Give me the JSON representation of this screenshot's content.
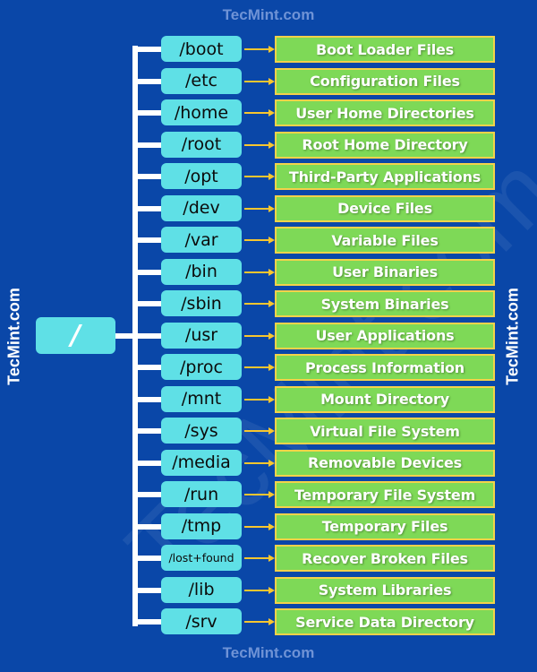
{
  "site": {
    "top_label": "TecMint.com",
    "bottom_label": "TecMint.com",
    "left_label": "TecMint.com",
    "right_label": "TecMint.com",
    "watermark": "TecMint.com"
  },
  "colors": {
    "background": "#0a47a8",
    "dir_box": "#5fe0e6",
    "desc_box": "#7ed957",
    "desc_border": "#f4d24a",
    "arrow": "#f7c62f",
    "connector": "#ffffff"
  },
  "root": {
    "label": "/"
  },
  "directories": [
    {
      "path": "/boot",
      "description": "Boot Loader Files"
    },
    {
      "path": "/etc",
      "description": "Configuration Files"
    },
    {
      "path": "/home",
      "description": "User Home Directories"
    },
    {
      "path": "/root",
      "description": "Root Home Directory"
    },
    {
      "path": "/opt",
      "description": "Third-Party Applications"
    },
    {
      "path": "/dev",
      "description": "Device Files"
    },
    {
      "path": "/var",
      "description": "Variable Files"
    },
    {
      "path": "/bin",
      "description": "User Binaries"
    },
    {
      "path": "/sbin",
      "description": "System Binaries"
    },
    {
      "path": "/usr",
      "description": "User Applications"
    },
    {
      "path": "/proc",
      "description": "Process Information"
    },
    {
      "path": "/mnt",
      "description": "Mount Directory"
    },
    {
      "path": "/sys",
      "description": "Virtual File System"
    },
    {
      "path": "/media",
      "description": "Removable Devices"
    },
    {
      "path": "/run",
      "description": "Temporary File System"
    },
    {
      "path": "/tmp",
      "description": "Temporary Files"
    },
    {
      "path": "/lost+found",
      "description": "Recover Broken Files"
    },
    {
      "path": "/lib",
      "description": "System Libraries"
    },
    {
      "path": "/srv",
      "description": "Service Data Directory"
    }
  ]
}
